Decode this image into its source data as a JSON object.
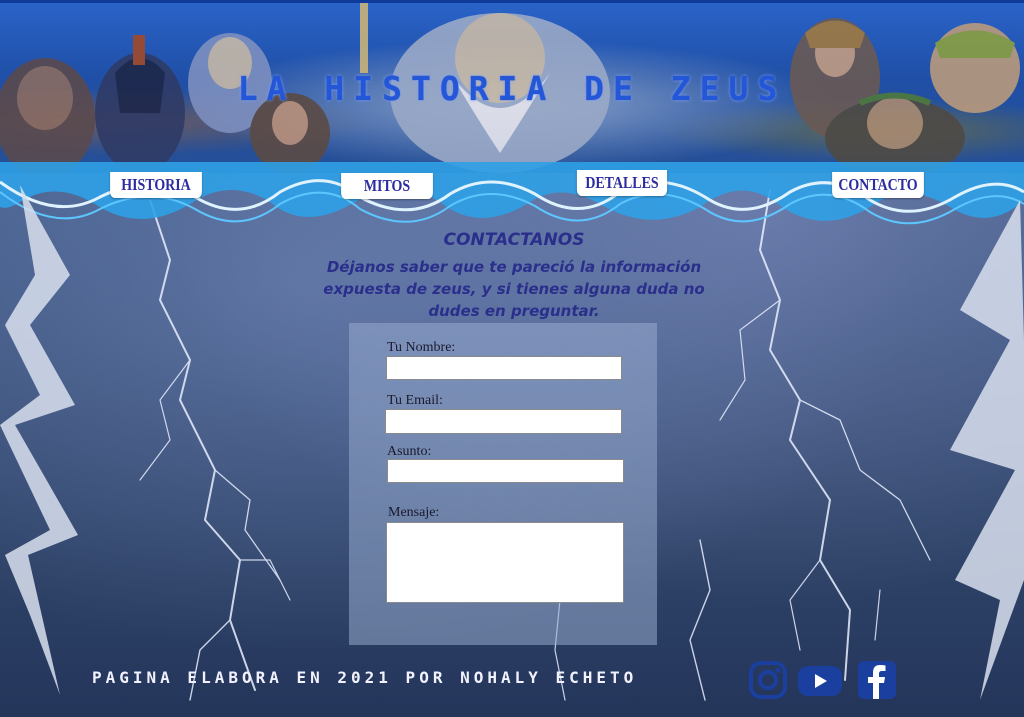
{
  "header": {
    "site_title": "LA HISTORIA DE ZEUS"
  },
  "nav": {
    "items": [
      {
        "label": "HISTORIA"
      },
      {
        "label": "MITOS"
      },
      {
        "label": "DETALLES"
      },
      {
        "label": "CONTACTO"
      }
    ]
  },
  "contact": {
    "heading": "CONTACTANOS",
    "intro": "Déjanos saber que te pareció la información expuesta de zeus,  y si tienes alguna duda no dudes en preguntar.",
    "form": {
      "name_label": "Tu Nombre:",
      "name_value": "",
      "email_label": "Tu Email:",
      "email_value": "",
      "subject_label": "Asunto:",
      "subject_value": "",
      "message_label": "Mensaje:",
      "message_value": ""
    }
  },
  "footer": {
    "text": "PAGINA ELABORA EN 2021 POR NOHALY ECHETO",
    "social": [
      {
        "icon": "instagram-icon"
      },
      {
        "icon": "youtube-icon"
      },
      {
        "icon": "facebook-icon"
      }
    ]
  },
  "colors": {
    "nav_text": "#2c2ca0",
    "accent": "#2456d8",
    "social_icon": "#1b3f9e",
    "intro_text": "#2b2f8c"
  }
}
